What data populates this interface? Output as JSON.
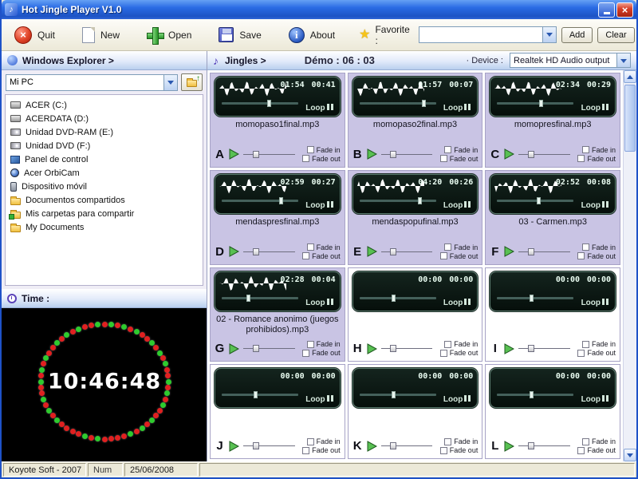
{
  "window": {
    "title": "Hot Jingle Player V1.0"
  },
  "colors": {
    "titlebar_blue": "#2a6be4",
    "loaded_cell_bg": "#c9c4e4",
    "display_bg": "#0a1712",
    "dot_red": "#e02020",
    "dot_green": "#2ecb2e",
    "play_green": "#58c052"
  },
  "toolbar": {
    "buttons": [
      {
        "id": "quit",
        "label": "Quit",
        "icon": "quit-icon"
      },
      {
        "id": "new",
        "label": "New",
        "icon": "new-document-icon"
      },
      {
        "id": "open",
        "label": "Open",
        "icon": "open-plus-icon"
      },
      {
        "id": "save",
        "label": "Save",
        "icon": "save-floppy-icon"
      },
      {
        "id": "about",
        "label": "About",
        "icon": "about-info-icon"
      }
    ],
    "favorite_label": "Favorite :",
    "favorite_value": "",
    "favorite_icon": "star-icon",
    "add_label": "Add",
    "clear_label": "Clear"
  },
  "explorer": {
    "header": "Windows Explorer >",
    "combo_value": "Mi PC",
    "items": [
      {
        "label": "ACER (C:)",
        "icon": "drive"
      },
      {
        "label": "ACERDATA (D:)",
        "icon": "drive"
      },
      {
        "label": "Unidad DVD-RAM (E:)",
        "icon": "dvd"
      },
      {
        "label": "Unidad DVD (F:)",
        "icon": "dvd"
      },
      {
        "label": "Panel de control",
        "icon": "control"
      },
      {
        "label": "Acer OrbiCam",
        "icon": "camera"
      },
      {
        "label": "Dispositivo móvil",
        "icon": "mobile"
      },
      {
        "label": "Documentos compartidos",
        "icon": "folder"
      },
      {
        "label": "Mis carpetas para compartir",
        "icon": "share"
      },
      {
        "label": "My Documents",
        "icon": "folder"
      }
    ]
  },
  "time_panel": {
    "header": "Time :",
    "clock": "10:46:48"
  },
  "jingles": {
    "header": "Jingles >",
    "demo_label": "Démo : 06 : 03",
    "device_label": "· Device :",
    "device_value": "Realtek HD Audio output",
    "loop_label": "Loop",
    "fade_in_label": "Fade in",
    "fade_out_label": "Fade out",
    "volume_pos": 0.18,
    "cells": [
      {
        "letter": "A",
        "file": "momopaso1final.mp3",
        "time_elapsed": "01:54",
        "time_remaining": "00:41",
        "loaded": true,
        "slider_pos": 0.62
      },
      {
        "letter": "B",
        "file": "momopaso2final.mp3",
        "time_elapsed": "01:57",
        "time_remaining": "00:07",
        "loaded": true,
        "slider_pos": 0.85
      },
      {
        "letter": "C",
        "file": "momopresfinal.mp3",
        "time_elapsed": "02:34",
        "time_remaining": "00:29",
        "loaded": true,
        "slider_pos": 0.58
      },
      {
        "letter": "D",
        "file": "mendaspresfinal.mp3",
        "time_elapsed": "02:59",
        "time_remaining": "00:27",
        "loaded": true,
        "slider_pos": 0.78
      },
      {
        "letter": "E",
        "file": "mendaspopufinal.mp3",
        "time_elapsed": "04:20",
        "time_remaining": "00:26",
        "loaded": true,
        "slider_pos": 0.8
      },
      {
        "letter": "F",
        "file": "03 - Carmen.mp3",
        "time_elapsed": "02:52",
        "time_remaining": "00:08",
        "loaded": true,
        "slider_pos": 0.55
      },
      {
        "letter": "G",
        "file": "02 - Romance anonimo (juegos prohibidos).mp3",
        "time_elapsed": "02:28",
        "time_remaining": "00:04",
        "loaded": true,
        "slider_pos": 0.35
      },
      {
        "letter": "H",
        "file": "",
        "time_elapsed": "00:00",
        "time_remaining": "00:00",
        "loaded": false,
        "slider_pos": 0.45
      },
      {
        "letter": "I",
        "file": "",
        "time_elapsed": "00:00",
        "time_remaining": "00:00",
        "loaded": false,
        "slider_pos": 0.45
      },
      {
        "letter": "J",
        "file": "",
        "time_elapsed": "00:00",
        "time_remaining": "00:00",
        "loaded": false,
        "slider_pos": 0.45
      },
      {
        "letter": "K",
        "file": "",
        "time_elapsed": "00:00",
        "time_remaining": "00:00",
        "loaded": false,
        "slider_pos": 0.45
      },
      {
        "letter": "L",
        "file": "",
        "time_elapsed": "00:00",
        "time_remaining": "00:00",
        "loaded": false,
        "slider_pos": 0.45
      }
    ]
  },
  "statusbar": {
    "company": "Koyote Soft - 2007",
    "num": "Num",
    "date": "25/06/2008"
  }
}
